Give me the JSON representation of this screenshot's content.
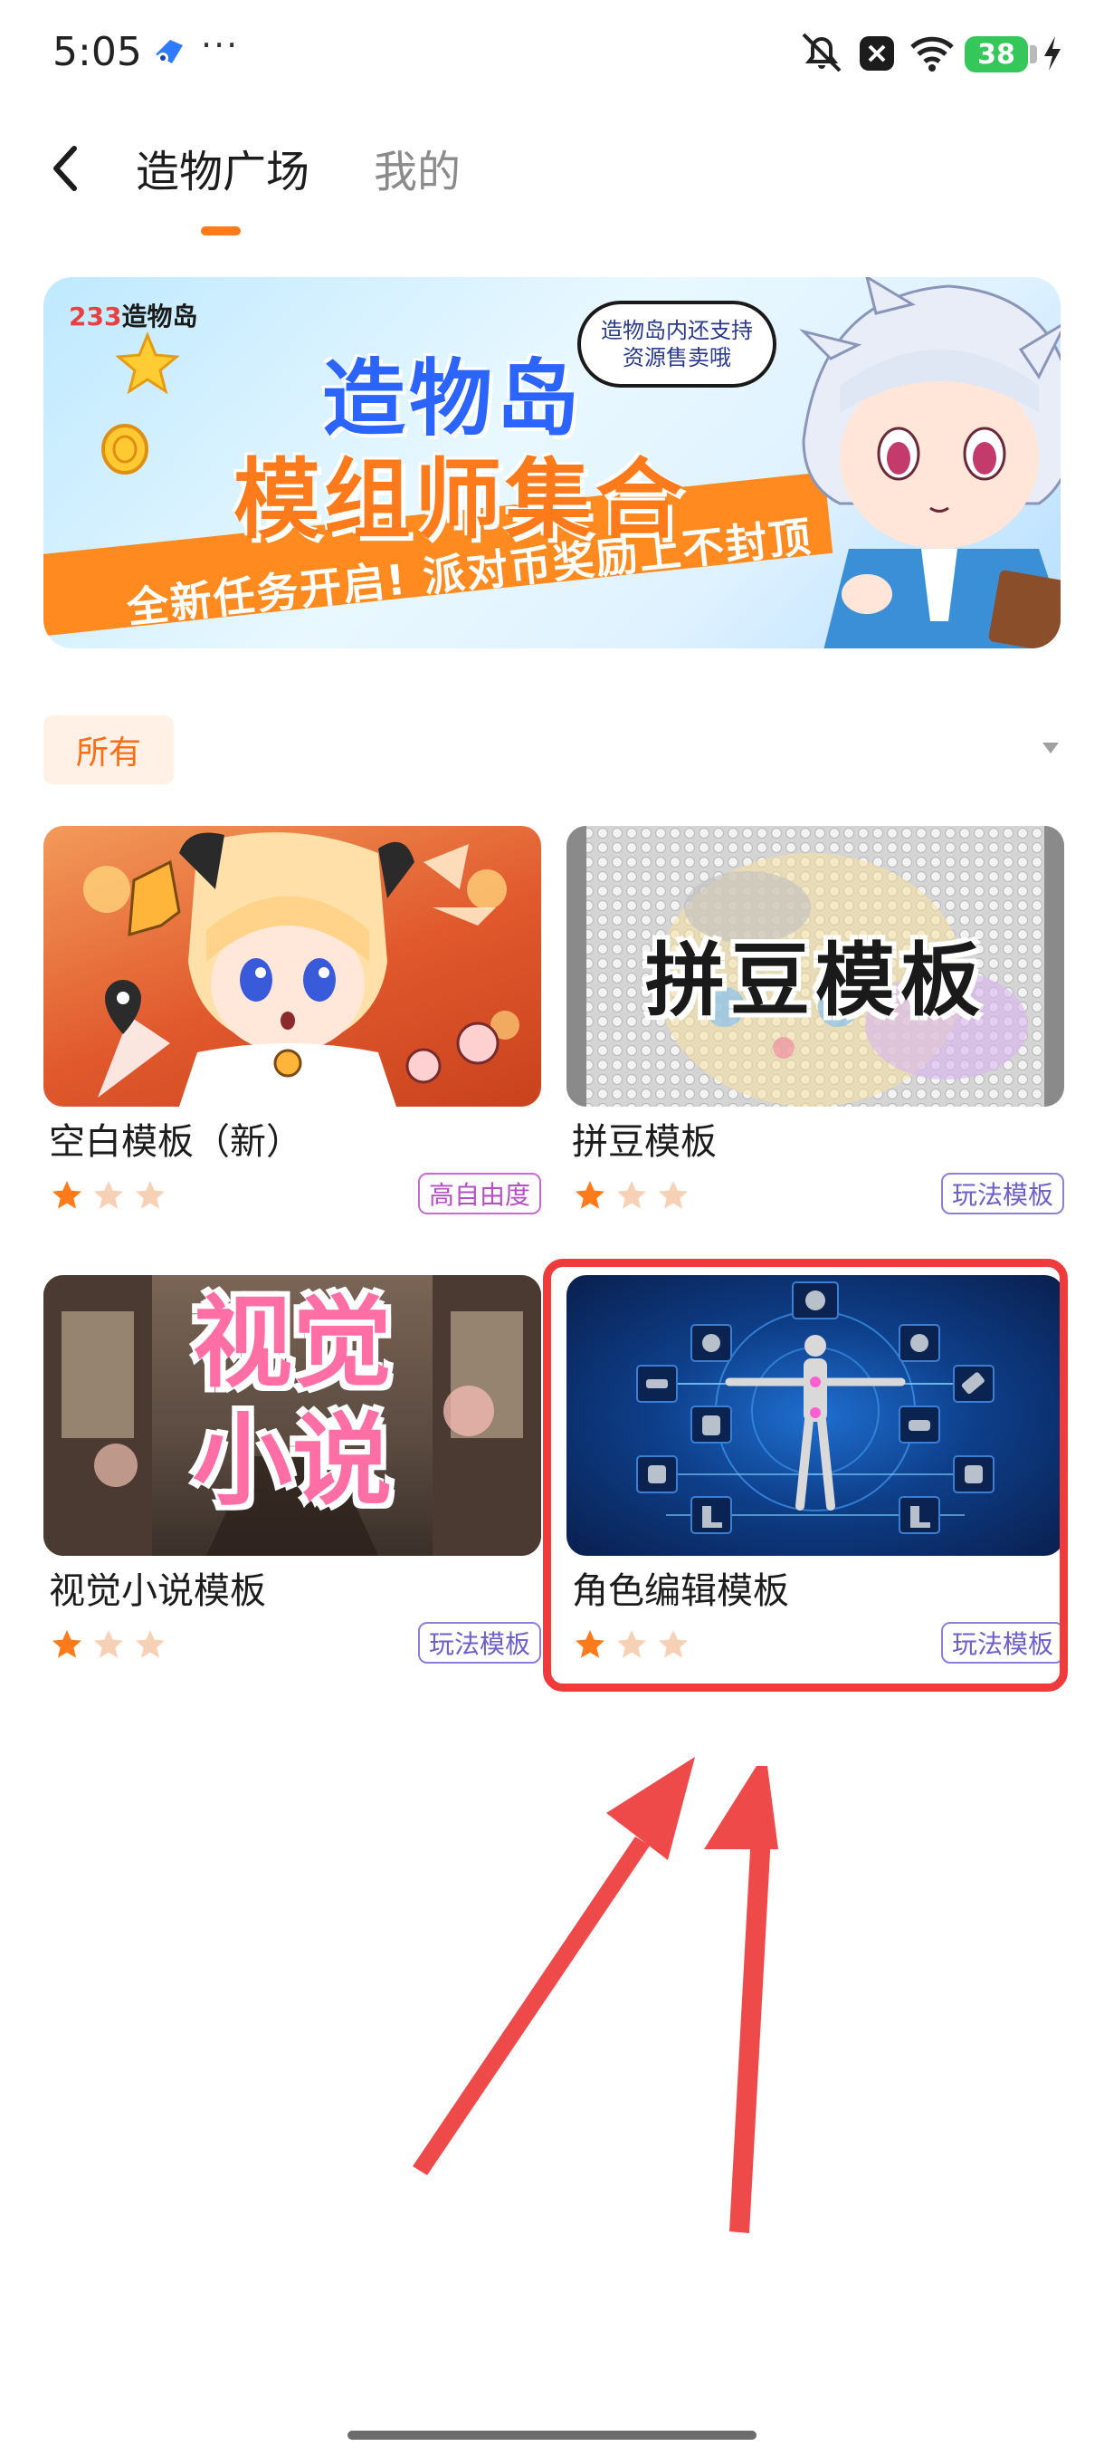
{
  "status_bar": {
    "time": "5:05",
    "more": "···",
    "battery": "38",
    "icons": [
      "app-logo-icon",
      "silent-icon",
      "notification-x-icon",
      "wifi-icon",
      "battery-icon",
      "charging-icon"
    ]
  },
  "header": {
    "tabs": [
      {
        "label": "造物广场",
        "active": true
      },
      {
        "label": "我的",
        "active": false
      }
    ],
    "accent_color": "#ff7a1a"
  },
  "banner": {
    "brand_number": "233",
    "brand_name": "造物岛",
    "title": "造物岛",
    "subtitle": "模组师集合",
    "slogan": "全新任务开启! 派对币奖励上不封顶",
    "bubble_line1": "造物岛内还支持",
    "bubble_line2": "资源售卖哦"
  },
  "filter": {
    "selected": "所有"
  },
  "templates": [
    {
      "title": "空白模板（新）",
      "tag": "高自由度",
      "stars": 1
    },
    {
      "title": "拼豆模板",
      "tag": "玩法模板",
      "stars": 1,
      "image_text": "拼豆模板"
    },
    {
      "title": "视觉小说模板",
      "tag": "玩法模板",
      "stars": 1,
      "image_text_1": "视觉",
      "image_text_2": "小说"
    },
    {
      "title": "角色编辑模板",
      "tag": "玩法模板",
      "stars": 1
    }
  ],
  "colors": {
    "highlight": "#ef3b3b",
    "star_filled": "#ff7a1a",
    "star_empty": "#f7d1b5"
  }
}
